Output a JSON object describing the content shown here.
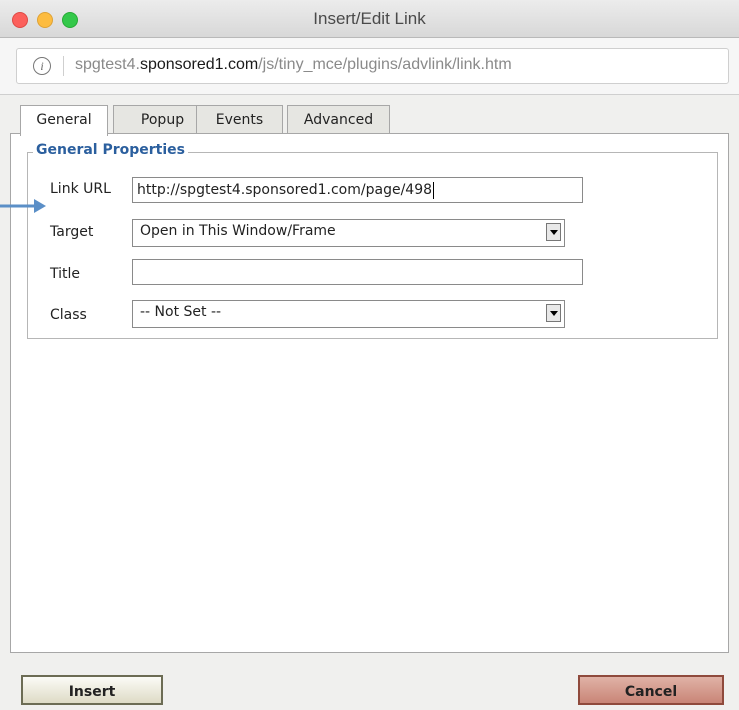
{
  "window": {
    "title": "Insert/Edit Link"
  },
  "url_bar": {
    "prefix": "spgtest4.",
    "host": "sponsored1.com",
    "path": "/js/tiny_mce/plugins/advlink/link.htm"
  },
  "tabs": [
    {
      "label": "General",
      "active": true
    },
    {
      "label": "Popup",
      "active": false
    },
    {
      "label": "Events",
      "active": false
    },
    {
      "label": "Advanced",
      "active": false
    }
  ],
  "general": {
    "legend": "General Properties",
    "link_url": {
      "label": "Link URL",
      "value": "http://spgtest4.sponsored1.com/page/498"
    },
    "target": {
      "label": "Target",
      "value": "Open in This Window/Frame"
    },
    "title": {
      "label": "Title",
      "value": ""
    },
    "class": {
      "label": "Class",
      "value": "-- Not Set --"
    }
  },
  "buttons": {
    "insert": "Insert",
    "cancel": "Cancel"
  },
  "colors": {
    "legend": "#2b5f9e",
    "annotation_arrow": "#5b8fc7",
    "cancel_button": "#c98577"
  }
}
